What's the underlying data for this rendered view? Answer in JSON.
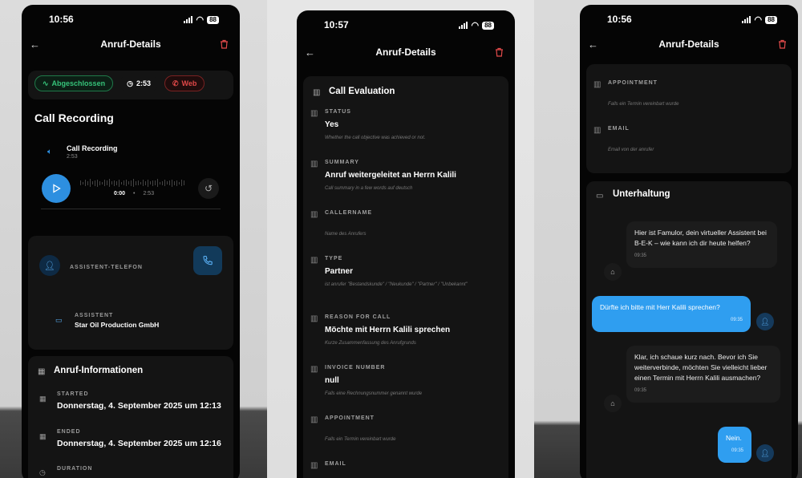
{
  "colors": {
    "accent": "#2d8fe0",
    "danger": "#e34b4b",
    "success": "#36c279",
    "background": "#050505",
    "card": "#141414"
  },
  "phone1": {
    "time": "10:56",
    "battery": "88",
    "title": "Anruf-Details",
    "pills": {
      "status": "Abgeschlossen",
      "duration": "2:53",
      "source": "Web"
    },
    "recording_section": "Call Recording",
    "recording": {
      "name": "Call Recording",
      "length": "2:53",
      "current": "0:00",
      "sep": "•",
      "total": "2:53"
    },
    "assistant_phone_label": "ASSISTENT-TELEFON",
    "assistant": {
      "label": "ASSISTENT",
      "value": "Star Oil Production GmbH"
    },
    "info_title": "Anruf-Informationen",
    "started": {
      "label": "STARTED",
      "value": "Donnerstag, 4. September 2025 um 12:13"
    },
    "ended": {
      "label": "ENDED",
      "value": "Donnerstag, 4. September 2025 um 12:16"
    },
    "duration_label": "DURATION"
  },
  "phone2": {
    "time": "10:57",
    "battery": "88",
    "title": "Anruf-Details",
    "section": "Call Evaluation",
    "fields": [
      {
        "label": "STATUS",
        "value": "Yes",
        "hint": "Whether the call objective was achieved or not."
      },
      {
        "label": "SUMMARY",
        "value": "Anruf weitergeleitet an Herrn Kalili",
        "hint": "Call summary in a few words auf deutsch"
      },
      {
        "label": "CALLERNAME",
        "value": "",
        "hint": "Name des Anrufers"
      },
      {
        "label": "TYPE",
        "value": "Partner",
        "hint": "ist anrufer \"Bestandskunde\" / \"Neukunde\" / \"Partner\" / \"Unbekannt\""
      },
      {
        "label": "REASON FOR CALL",
        "value": "Möchte mit Herrn Kalili sprechen",
        "hint": "Kurze Zusammenfassung des Anrufgrunds"
      },
      {
        "label": "INVOICE NUMBER",
        "value": "null",
        "hint": "Falls eine Rechnungsnummer genannt wurde"
      },
      {
        "label": "APPOINTMENT",
        "value": "",
        "hint": "Falls ein Termin vereinbart wurde"
      },
      {
        "label": "EMAIL",
        "value": "",
        "hint": ""
      }
    ]
  },
  "phone3": {
    "time": "10:56",
    "battery": "88",
    "title": "Anruf-Details",
    "appointment": {
      "label": "APPOINTMENT",
      "hint": "Falls ein Termin vereinbart wurde"
    },
    "email": {
      "label": "EMAIL",
      "hint": "Email von der anrufer"
    },
    "chat_title": "Unterhaltung",
    "messages": [
      {
        "text": "Hier ist Famulor, dein virtueller Assistent bei B-E-K – wie kann ich dir heute helfen?",
        "time": "09:35"
      },
      {
        "text": "Dürfte ich bitte mit Herr Kalili sprechen?",
        "time": "09:35"
      },
      {
        "text": "Klar, ich schaue kurz nach. Bevor ich Sie weiterverbinde, möchten Sie vielleicht lieber einen Termin mit Herrn Kalili ausmachen?",
        "time": "09:35"
      },
      {
        "text": "Nein.",
        "time": "09:35"
      }
    ]
  }
}
